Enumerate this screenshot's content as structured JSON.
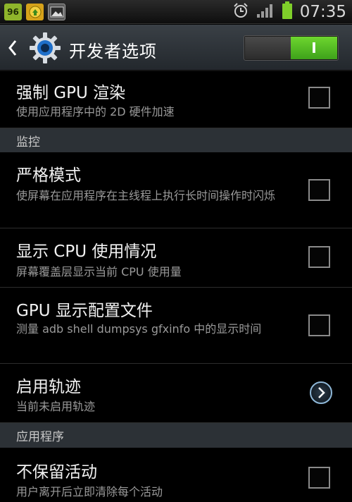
{
  "status_bar": {
    "battery_number": "96",
    "time": "07:35",
    "icons": [
      "battery-level-icon",
      "market-icon",
      "gallery-icon",
      "alarm-icon",
      "signal-icon",
      "battery-icon"
    ]
  },
  "action_bar": {
    "title": "开发者选项",
    "toggle_state": "I",
    "toggle_on": true
  },
  "items": {
    "gpu_render": {
      "title": "强制 GPU 渲染",
      "subtitle": "使用应用程序中的 2D 硬件加速",
      "checked": false
    },
    "section_monitor": "监控",
    "strict_mode": {
      "title": "严格模式",
      "subtitle": "使屏幕在应用程序在主线程上执行长时间操作时闪烁",
      "checked": false
    },
    "show_cpu": {
      "title": "显示 CPU 使用情况",
      "subtitle": "屏幕覆盖层显示当前 CPU 使用量",
      "checked": false
    },
    "gpu_profile": {
      "title": "GPU 显示配置文件",
      "subtitle": "测量 adb shell dumpsys gfxinfo 中的显示时间",
      "checked": false
    },
    "traces": {
      "title": "启用轨迹",
      "subtitle": "当前未启用轨迹"
    },
    "section_apps": "应用程序",
    "dont_keep": {
      "title": "不保留活动",
      "subtitle": "用户离开后立即清除每个活动",
      "checked": false
    }
  },
  "colors": {
    "toggle_on": "#4fbf22",
    "section_bg": "#2c3136",
    "chevron_ring": "#8fb8d8"
  }
}
